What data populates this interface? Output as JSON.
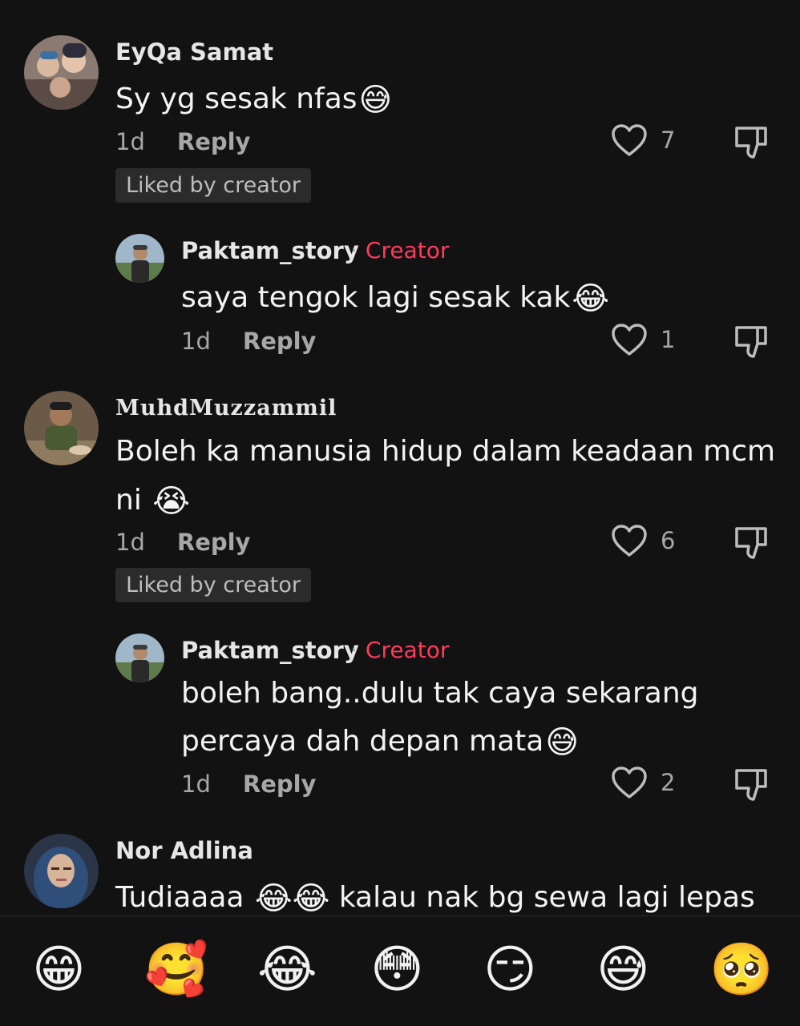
{
  "comments": [
    {
      "username": "EyQa Samat",
      "text": "Sy yg sesak nfas",
      "emoji": "😅",
      "time": "1d",
      "reply_label": "Reply",
      "likes": "7",
      "badge": "Liked by creator",
      "avatar_icon": "avatar-photo-family"
    },
    {
      "username": "Paktam_story",
      "creator_label": "Creator",
      "text": "saya tengok lagi sesak kak",
      "emoji": "😂",
      "time": "1d",
      "reply_label": "Reply",
      "likes": "1",
      "avatar_icon": "avatar-photo-man-cap"
    },
    {
      "username": "MuhdMuzzammil",
      "text_line1": "Boleh ka manusia hidup dalam keadaan mcm",
      "text_line2": "ni",
      "emoji": "😭",
      "time": "1d",
      "reply_label": "Reply",
      "likes": "6",
      "badge": "Liked by creator",
      "avatar_icon": "avatar-photo-man-dining"
    },
    {
      "username": "Paktam_story",
      "creator_label": "Creator",
      "text_line1": "boleh bang..dulu tak caya sekarang",
      "text_line2": "percaya dah depan mata",
      "emoji": "😅",
      "time": "1d",
      "reply_label": "Reply",
      "likes": "2",
      "avatar_icon": "avatar-photo-man-cap"
    },
    {
      "username": "Nor Adlina",
      "text_before": "Tudiaaaa",
      "emoji": "😂😂",
      "text_after": "kalau nak bg sewa lagi lepas",
      "avatar_icon": "avatar-photo-woman-hijab"
    }
  ],
  "emoji_bar": [
    "😁",
    "🥰",
    "😂",
    "😳",
    "😏",
    "😅",
    "🥺"
  ],
  "colors": {
    "background": "#121212",
    "creator_accent": "#ff3b5c",
    "muted": "#a7a7a7",
    "badge_bg": "#2b2b2b"
  }
}
